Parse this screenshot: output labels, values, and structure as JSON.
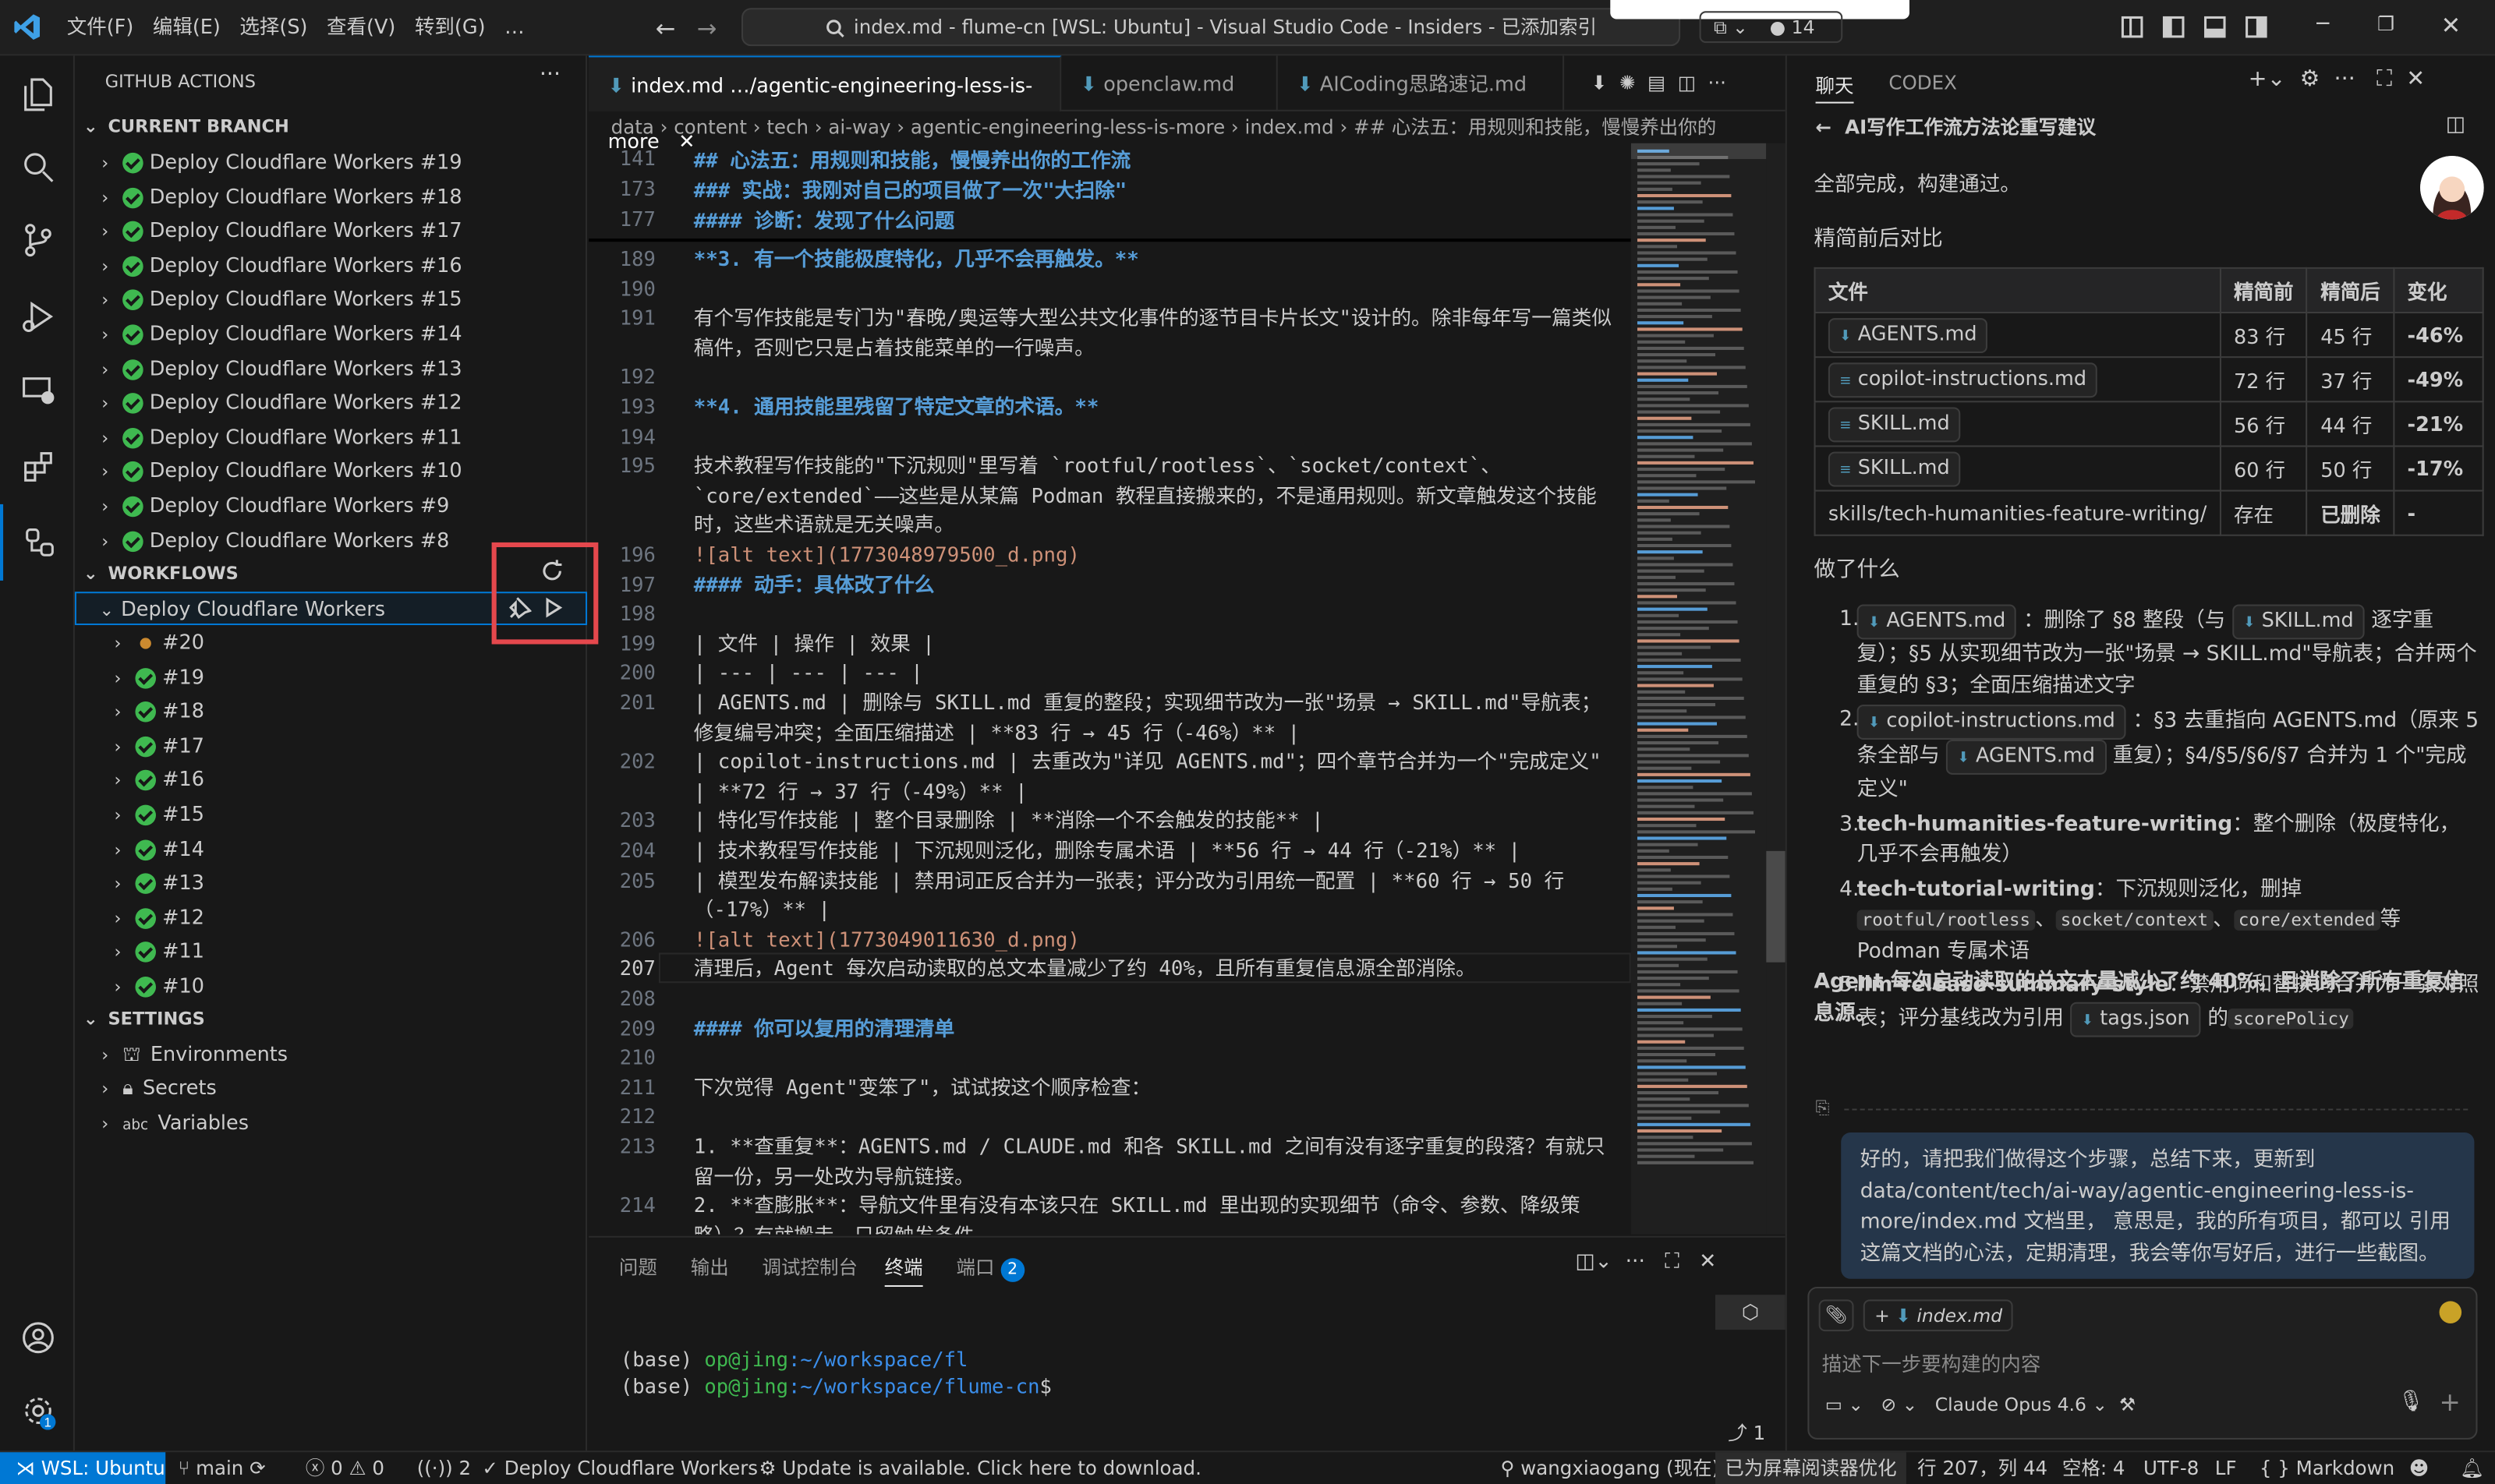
{
  "titlebar": {
    "menus": [
      "文件(F)",
      "编辑(E)",
      "选择(S)",
      "查看(V)",
      "转到(G)",
      "…"
    ],
    "command_center": "index.md - flume-cn [WSL: Ubuntu] - Visual Studio Code - Insiders - 已添加索引",
    "copilot_count": "14"
  },
  "sidebar": {
    "title": "GITHUB ACTIONS",
    "current_branch": "CURRENT BRANCH",
    "branch_runs": [
      "Deploy Cloudflare Workers #19",
      "Deploy Cloudflare Workers #18",
      "Deploy Cloudflare Workers #17",
      "Deploy Cloudflare Workers #16",
      "Deploy Cloudflare Workers #15",
      "Deploy Cloudflare Workers #14",
      "Deploy Cloudflare Workers #13",
      "Deploy Cloudflare Workers #12",
      "Deploy Cloudflare Workers #11",
      "Deploy Cloudflare Workers #10",
      "Deploy Cloudflare Workers #9",
      "Deploy Cloudflare Workers #8"
    ],
    "workflows": "WORKFLOWS",
    "workflow_name": "Deploy Cloudflare Workers",
    "workflow_runs": [
      "#20",
      "#19",
      "#18",
      "#17",
      "#16",
      "#15",
      "#14",
      "#13",
      "#12",
      "#11",
      "#10"
    ],
    "settings": "SETTINGS",
    "settings_items": [
      "Environments",
      "Secrets",
      "Variables"
    ]
  },
  "editor": {
    "tabs": [
      "index.md …/agentic-engineering-less-is-more",
      "openclaw.md",
      "AICoding思路速记.md"
    ],
    "breadcrumb": "data › content › tech › ai-way › agentic-engineering-less-is-more › index.md › ## 心法五：用规则和技能，慢慢养出你的",
    "sticky": [
      {
        "n": "141",
        "t": "## 心法五：用规则和技能，慢慢养出你的工作流"
      },
      {
        "n": "173",
        "t": "### 实战：我刚对自己的项目做了一次\"大扫除\""
      },
      {
        "n": "177",
        "t": "#### 诊断：发现了什么问题"
      }
    ],
    "lines": [
      {
        "n": "189",
        "t": "**3. 有一个技能极度特化，几乎不会再触发。**",
        "c": "bd",
        "rows": 1
      },
      {
        "n": "190",
        "t": "",
        "rows": 1
      },
      {
        "n": "191",
        "t": "有个写作技能是专门为\"春晚/奥运等大型公共文化事件的逐节目卡片长文\"设计的。除非每年写一篇类似稿件，否则它只是占着技能菜单的一行噪声。",
        "rows": 2
      },
      {
        "n": "192",
        "t": "",
        "rows": 1
      },
      {
        "n": "193",
        "t": "**4. 通用技能里残留了特定文章的术语。**",
        "c": "bd",
        "rows": 1
      },
      {
        "n": "194",
        "t": "",
        "rows": 1
      },
      {
        "n": "195",
        "t": "技术教程写作技能的\"下沉规则\"里写着 `rootful/rootless`、`socket/context`、`core/extended`——这些是从某篇 Podman 教程直接搬来的，不是通用规则。新文章触发这个技能时，这些术语就是无关噪声。",
        "rows": 3
      },
      {
        "n": "196",
        "t": "![alt text](1773048979500_d.png)",
        "c": "lk",
        "rows": 1
      },
      {
        "n": "197",
        "t": "#### 动手：具体改了什么",
        "c": "h",
        "rows": 1
      },
      {
        "n": "198",
        "t": "",
        "rows": 1
      },
      {
        "n": "199",
        "t": "| 文件 | 操作 | 效果 |",
        "rows": 1
      },
      {
        "n": "200",
        "t": "| --- | --- | --- |",
        "rows": 1
      },
      {
        "n": "201",
        "t": "| AGENTS.md | 删除与 SKILL.md 重复的整段；实现细节改为一张\"场景 → SKILL.md\"导航表；修复编号冲突；全面压缩描述 | **83 行 → 45 行（-46%）** |",
        "rows": 2
      },
      {
        "n": "202",
        "t": "| copilot-instructions.md | 去重改为\"详见 AGENTS.md\"；四个章节合并为一个\"完成定义\" | **72 行 → 37 行（-49%）** |",
        "rows": 2
      },
      {
        "n": "203",
        "t": "| 特化写作技能 | 整个目录删除 | **消除一个不会触发的技能** |",
        "rows": 1
      },
      {
        "n": "204",
        "t": "| 技术教程写作技能 | 下沉规则泛化，删除专属术语 | **56 行 → 44 行（-21%）** |",
        "rows": 1
      },
      {
        "n": "205",
        "t": "| 模型发布解读技能 | 禁用词正反合并为一张表；评分改为引用统一配置 | **60 行 → 50 行（-17%）** |",
        "rows": 2
      },
      {
        "n": "206",
        "t": "![alt text](1773049011630_d.png)",
        "c": "lk",
        "rows": 1
      },
      {
        "n": "207",
        "t": "清理后，Agent 每次启动读取的总文本量减少了约 40%，且所有重复信息源全部消除。",
        "rows": 1
      },
      {
        "n": "208",
        "t": "",
        "rows": 1
      },
      {
        "n": "209",
        "t": "#### 你可以复用的清理清单",
        "c": "h",
        "rows": 1
      },
      {
        "n": "210",
        "t": "",
        "rows": 1
      },
      {
        "n": "211",
        "t": "下次觉得 Agent\"变笨了\"，试试按这个顺序检查：",
        "rows": 1
      },
      {
        "n": "212",
        "t": "",
        "rows": 1
      },
      {
        "n": "213",
        "t": "1. **查重复**：AGENTS.md / CLAUDE.md 和各 SKILL.md 之间有没有逐字重复的段落？有就只留一份，另一处改为导航链接。",
        "rows": 2
      },
      {
        "n": "214",
        "t": "2. **查膨胀**：导航文件里有没有本该只在 SKILL.md 里出现的实现细节（命令、参数、降级策略）？有就搬走，只留触发条件。",
        "rows": 2
      }
    ]
  },
  "panel": {
    "tabs": [
      "问题",
      "输出",
      "调试控制台",
      "终端",
      "端口"
    ],
    "ports_badge": "2",
    "terminal": [
      {
        "prefix": "(base) ",
        "user": "op@jing",
        "path": ":~/workspace/fl",
        "tail": ""
      },
      {
        "prefix": "(base) ",
        "user": "op@jing",
        "path": ":~/workspace/flume-cn",
        "tail": "$"
      }
    ],
    "terminal_count": "1"
  },
  "chat": {
    "tabs": [
      "聊天",
      "CODEX"
    ],
    "thread_title": "AI写作工作流方法论重写建议",
    "done": "全部完成，构建通过。",
    "compare_title": "精简前后对比",
    "table_headers": [
      "文件",
      "精简前",
      "精简后",
      "变化"
    ],
    "table_rows": [
      [
        "AGENTS.md",
        "83 行",
        "45 行",
        "-46%"
      ],
      [
        "copilot-instructions.md",
        "72 行",
        "37 行",
        "-49%"
      ],
      [
        "SKILL.md",
        "56 行",
        "44 行",
        "-21%"
      ],
      [
        "SKILL.md",
        "60 行",
        "50 行",
        "-17%"
      ],
      [
        "skills/tech-humanities-feature-writing/",
        "存在",
        "已删除",
        "-"
      ]
    ],
    "what_title": "做了什么",
    "items": [
      {
        "n": "1.",
        "parts": [
          "AGENTS.md",
          "：删除了 §8 整段（与",
          "SKILL.md",
          "逐字重复）；§5 从实现细节改为一张\"场景 → SKILL.md\"导航表；合并两个重复的 §3；全面压缩描述文字"
        ]
      },
      {
        "n": "2.",
        "parts": [
          "copilot-instructions.md",
          "：§3 去重指向 AGENTS.md（原来 5 条全部与",
          "AGENTS.md",
          "重复）；§4/§5/§6/§7 合并为 1 个\"完成定义\""
        ]
      },
      {
        "n": "3.",
        "parts": [
          "tech-humanities-feature-writing",
          "：整个删除（极度特化，几乎不会再触发）"
        ]
      },
      {
        "n": "4.",
        "parts": [
          "tech-tutorial-writing",
          "：下沉规则泛化，删掉",
          "rootful/rootless",
          "、",
          "socket/context",
          "、",
          "core/extended",
          "等 Podman 专属术语"
        ]
      },
      {
        "n": "5.",
        "parts": [
          "llm-release-summary-style",
          "：禁用词和替换词合并为一张对照表；评分基线改为引用",
          "tags.json",
          "的",
          "scorePolicy"
        ]
      }
    ],
    "summary": "Agent 每次启动读取的总文本量减少了约 40%，且消除了所有重复信息源。",
    "user_message": "好的，请把我们做得这个步骤，总结下来，更新到 data/content/tech/ai-way/agentic-engineering-less-is-more/index.md 文档里， 意思是，我的所有项目，都可以 引用这篇文档的心法，定期清理，我会等你写好后，进行一些截图。",
    "attachment": "index.md",
    "input_placeholder": "描述下一步要构建的内容",
    "model": "Claude Opus 4.6"
  },
  "status": {
    "remote": "WSL: Ubuntu",
    "branch": "main",
    "errors": "0",
    "warnings": "0",
    "ports": "2",
    "workflow": "Deploy Cloudflare Workers",
    "update": "Update is available. Click here to download.",
    "user": "wangxiaogang (现在)",
    "screen_reader": "已为屏幕阅读器优化",
    "position": "行 207，列 44",
    "spaces": "空格: 4",
    "encoding": "UTF-8",
    "eol": "LF",
    "language": "Markdown"
  },
  "accent_colors": {
    "success": "#3fb950",
    "highlight_box": "#e5484d",
    "status_remote": "#0078d4",
    "heading": "#569cd6"
  }
}
